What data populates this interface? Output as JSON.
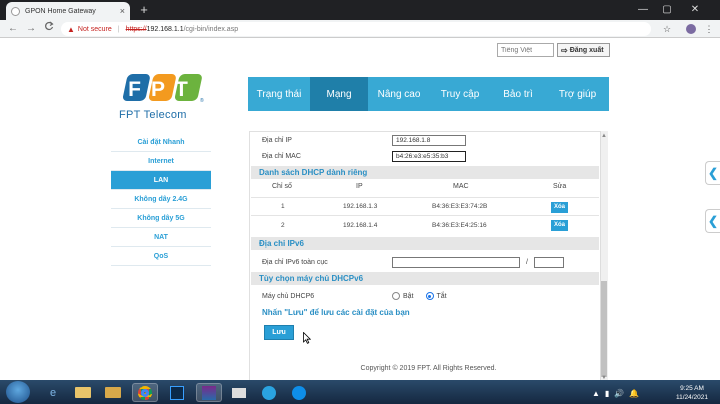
{
  "browser": {
    "tab_title": "GPON Home Gateway",
    "tab_close": "×",
    "new_tab": "+",
    "window_controls": [
      "—",
      "▢",
      "✕"
    ],
    "nav_back": "←",
    "nav_forward": "→",
    "nav_reload": "C",
    "security_icon": "warning-triangle",
    "security_text": "Not secure",
    "url_scheme": "https://",
    "url_host": "192.168.1.1",
    "url_path": "/cgi-bin/index.asp",
    "star": "☆",
    "menu": "⋮"
  },
  "header": {
    "language_placeholder": "Tiếng Việt",
    "logout_label": "Đăng xuất",
    "logo_letters": "FPT",
    "logo_trademark": "®",
    "brand_name": "FPT Telecom",
    "top_nav": [
      {
        "label": "Trạng thái",
        "active": false
      },
      {
        "label": "Mạng",
        "active": true
      },
      {
        "label": "Nâng cao",
        "active": false
      },
      {
        "label": "Truy cập",
        "active": false
      },
      {
        "label": "Bảo trì",
        "active": false
      },
      {
        "label": "Trợ giúp",
        "active": false
      }
    ]
  },
  "side_nav": [
    {
      "label": "Cài đặt Nhanh",
      "active": false
    },
    {
      "label": "Internet",
      "active": false
    },
    {
      "label": "LAN",
      "active": true
    },
    {
      "label": "Không dây 2.4G",
      "active": false
    },
    {
      "label": "Không dây 5G",
      "active": false
    },
    {
      "label": "NAT",
      "active": false
    },
    {
      "label": "QoS",
      "active": false
    }
  ],
  "form": {
    "ip_label": "Địa chỉ IP",
    "ip_value": "192.168.1.8",
    "mac_label": "Địa chỉ MAC",
    "mac_value": "b4:26:e3:e5:35:b3",
    "dhcp_section_title": "Danh sách DHCP dành riêng",
    "dhcp_columns": [
      "Chỉ số",
      "IP",
      "MAC",
      "Sửa"
    ],
    "dhcp_rows": [
      {
        "index": "1",
        "ip": "192.168.1.3",
        "mac": "B4:36:E3:E3:74:2B",
        "action": "Xóa"
      },
      {
        "index": "2",
        "ip": "192.168.1.4",
        "mac": "B4:36:E3:E4:25:16",
        "action": "Xóa"
      }
    ],
    "ipv6_section_title": "Địa chỉ IPv6",
    "ipv6_global_label": "Địa chỉ IPv6 toàn cục",
    "ipv6_global_value": "",
    "ipv6_prefix_sep": "/",
    "ipv6_prefix_value": "",
    "dhcpv6_section_title": "Tùy chọn máy chủ DHCPv6",
    "dhcpv6_label": "Máy chủ DHCP6",
    "dhcpv6_on": "Bật",
    "dhcpv6_off": "Tắt",
    "dhcpv6_selected": "Tắt",
    "save_hint": "Nhấn \"Lưu\" để lưu các cài đặt của bạn",
    "save_label": "Lưu",
    "copyright": "Copyright © 2019 FPT. All Rights Reserved."
  },
  "side_tabs": [
    "❮",
    "❮"
  ],
  "taskbar": {
    "apps": [
      "file-explorer",
      "internet-explorer",
      "folder",
      "chrome",
      "photoshop",
      "winrar",
      "email",
      "telegram",
      "teamviewer"
    ],
    "tray_icons": [
      "▲",
      "▮",
      "🔊",
      "🔔"
    ],
    "time": "9:25 AM",
    "date": "11/24/2021"
  },
  "colors": {
    "accent": "#2a9fd6",
    "nav_bar": "#38a9d4",
    "nav_active": "#1f7fa9",
    "logo_blue": "#1f6ea8",
    "logo_orange": "#f39a1f",
    "logo_green": "#6cb33e"
  }
}
